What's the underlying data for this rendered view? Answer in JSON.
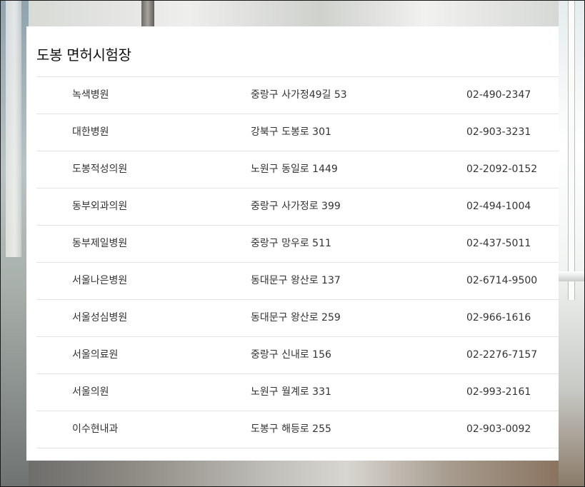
{
  "panel": {
    "title": "도봉 면허시험장"
  },
  "hospitals": [
    {
      "name": "녹색병원",
      "address": "중랑구 사가정49길 53",
      "phone": "02-490-2347"
    },
    {
      "name": "대한병원",
      "address": "강북구 도봉로 301",
      "phone": "02-903-3231"
    },
    {
      "name": "도봉적성의원",
      "address": "노원구 동일로 1449",
      "phone": "02-2092-0152"
    },
    {
      "name": "동부외과의원",
      "address": "중랑구 사가정로 399",
      "phone": "02-494-1004"
    },
    {
      "name": "동부제일병원",
      "address": "중랑구 망우로 511",
      "phone": "02-437-5011"
    },
    {
      "name": "서울나은병원",
      "address": "동대문구 왕산로 137",
      "phone": "02-6714-9500"
    },
    {
      "name": "서울성심병원",
      "address": "동대문구 왕산로 259",
      "phone": "02-966-1616"
    },
    {
      "name": "서울의료원",
      "address": "중랑구 신내로 156",
      "phone": "02-2276-7157"
    },
    {
      "name": "서울의원",
      "address": "노원구 월계로 331",
      "phone": "02-993-2161"
    },
    {
      "name": "이수현내과",
      "address": "도봉구 해등로 255",
      "phone": "02-903-0092"
    }
  ]
}
